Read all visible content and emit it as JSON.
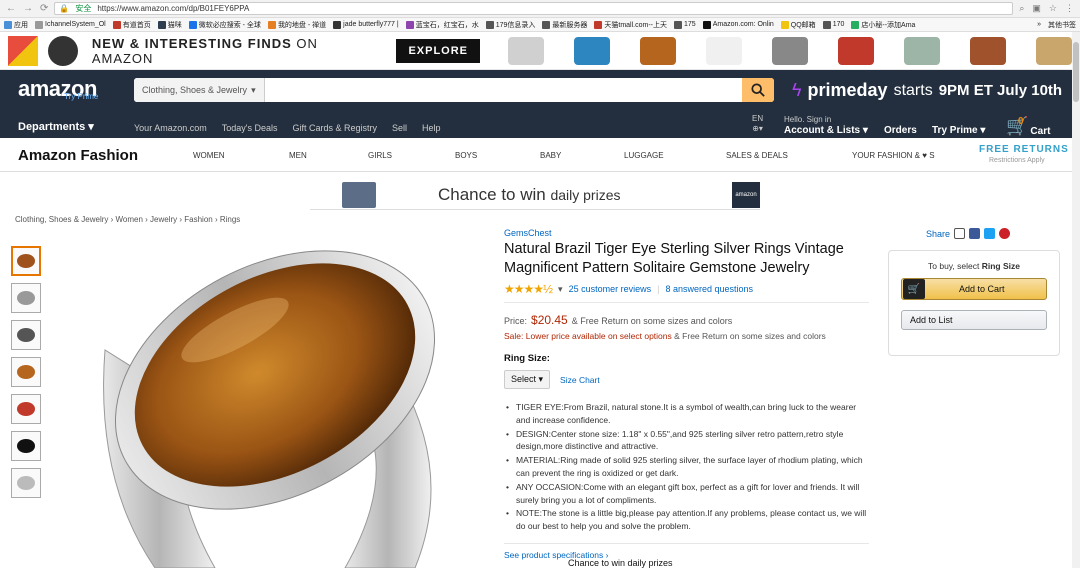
{
  "browser": {
    "secure_label": "安全",
    "url": "https://www.amazon.com/dp/B01FEY6PPA",
    "bookmarks": [
      "应用",
      "IchannelSystem_Ol",
      "有道首页",
      "猫咪",
      "微软必应搜索 - 全球",
      "我的地盘 - 禅道",
      "jade butterfly777 |",
      "蓝宝石，红宝石，水",
      "179信息录入",
      "最新服务器",
      "天猫tmall.com--上天",
      "175",
      "Amazon.com: Onlin",
      "QQ邮箱",
      "170",
      "店小秘--添加Ama"
    ],
    "bookmarks_more": "»",
    "other_bookmarks": "其他书签"
  },
  "promo": {
    "text_prefix": "NEW & INTERESTING FINDS ",
    "text_suffix": "ON AMAZON",
    "explore_label": "EXPLORE",
    "item_colors": [
      "#d0d0d0",
      "#2e86c1",
      "#b5651d",
      "#f0f0f0",
      "#888",
      "#c0392b",
      "#9db5a6",
      "#a0522d",
      "#c9a66b"
    ]
  },
  "header": {
    "logo": "amazon",
    "logo_sub": "Try Prime",
    "search_dept": "Clothing, Shoes & Jewelry",
    "search_placeholder": "",
    "prime_prefix": "primeday",
    "prime_middle": "starts",
    "prime_suffix": "9PM ET July 10th",
    "departments": "Departments",
    "nav_links": [
      "Your Amazon.com",
      "Today's Deals",
      "Gift Cards & Registry",
      "Sell",
      "Help"
    ],
    "lang_code": "EN",
    "hello": "Hello. Sign in",
    "account": "Account & Lists",
    "orders": "Orders",
    "try_prime": "Try Prime",
    "cart_count": "0",
    "cart": "Cart"
  },
  "fashion_nav": {
    "title": "Amazon Fashion",
    "items": [
      "WOMEN",
      "MEN",
      "GIRLS",
      "BOYS",
      "BABY",
      "LUGGAGE",
      "SALES & DEALS",
      "YOUR FASHION & ♥ S"
    ],
    "free_returns": "FREE RETURNS",
    "free_returns_sub": "Restrictions Apply"
  },
  "banner": {
    "text_main": "Chance to win ",
    "text_sub": "daily prizes",
    "logo": "amazon"
  },
  "breadcrumb": [
    "Clothing, Shoes & Jewelry",
    "Women",
    "Jewelry",
    "Fashion",
    "Rings"
  ],
  "thumbs": [
    {
      "color": "#a0521d",
      "selected": true
    },
    {
      "color": "#999",
      "selected": false
    },
    {
      "color": "#555",
      "selected": false
    },
    {
      "color": "#b5651d",
      "selected": false
    },
    {
      "color": "#c0392b",
      "selected": false
    },
    {
      "color": "#111",
      "selected": false
    },
    {
      "color": "#bbb",
      "selected": false
    }
  ],
  "product": {
    "brand": "GemsChest",
    "title": "Natural Brazil Tiger Eye Sterling Silver Rings Vintage Magnificent Pattern Solitaire Gemstone Jewelry",
    "stars": "★★★★½",
    "reviews": "25 customer reviews",
    "answered": "8 answered questions",
    "price_label": "Price:",
    "price": "$20.45",
    "price_note": "& Free Return on some sizes and colors",
    "sale_label": "Sale:",
    "sale_text": "Lower price available on select options",
    "sale_note": "& Free Return on some sizes and colors",
    "size_label": "Ring Size:",
    "select_value": "Select",
    "size_chart": "Size Chart",
    "bullets": [
      "TIGER EYE:From Brazil, natural stone.It is a symbol of wealth,can bring luck to the wearer and increase confidence.",
      "DESIGN:Center stone size: 1.18\" x 0.55\",and 925 sterling silver retro pattern,retro style design,more distinctive and attractive.",
      "MATERIAL:Ring made of solid 925 sterling silver, the surface layer of rhodium plating, which can prevent the ring is oxidized or get dark.",
      "ANY OCCASION:Come with an elegant gift box, perfect as a gift for lover and friends. It will surely bring you a lot of compliments.",
      "NOTE:The stone is a little big,please pay attention.If any problems, please contact us, we will do our best to help you and solve the problem."
    ],
    "specs_link": "See product specifications ›",
    "bottom_promo": "Chance to win daily prizes"
  },
  "share": {
    "label": "Share"
  },
  "buybox": {
    "hint_prefix": "To buy, select ",
    "hint_bold": "Ring Size",
    "add_to_cart": "Add to Cart",
    "add_to_list": "Add to List"
  }
}
